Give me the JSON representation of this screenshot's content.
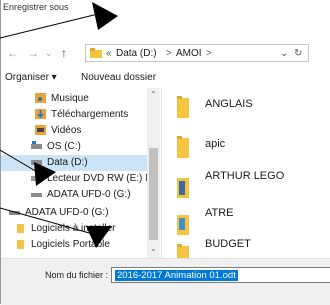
{
  "title": "Enregistrer sous",
  "address": {
    "back": "←",
    "forward": "→",
    "recent": "⌄",
    "up": "↑",
    "sep": "«",
    "crumbs": [
      "Data (D:)",
      ">",
      "AMOI",
      ">"
    ],
    "dropdown": "⌄",
    "refresh": "↻"
  },
  "toolbar": {
    "organize": "Organiser ▾",
    "new_folder": "Nouveau dossier"
  },
  "sidebar": {
    "items": [
      {
        "label": "Musique",
        "icon": "music-icon"
      },
      {
        "label": "Téléchargements",
        "icon": "download-icon"
      },
      {
        "label": "Vidéos",
        "icon": "video-icon"
      },
      {
        "label": "OS (C:)",
        "icon": "drive-icon"
      },
      {
        "label": "Data (D:)",
        "icon": "drive-icon"
      },
      {
        "label": "Lecteur DVD RW (E:) N",
        "icon": "dvd-icon"
      },
      {
        "label": "ADATA UFD-0 (G:)",
        "icon": "usb-icon"
      },
      {
        "label": "ADATA UFD-0 (G:)",
        "icon": "usb-icon"
      },
      {
        "label": "Logiciels à installer",
        "icon": "folder-icon"
      },
      {
        "label": "Logiciels Portable",
        "icon": "folder-icon"
      }
    ]
  },
  "folders": [
    "ANGLAIS",
    "apic",
    "ARTHUR LEGO",
    "ATRE",
    "BUDGET"
  ],
  "bottom": {
    "filename_label": "Nom du fichier :",
    "filename_value": "2016-2017 Animation 01.odt"
  },
  "colors": {
    "selection": "#cce4f7",
    "accent": "#0078d7",
    "folder": "#f5c542"
  }
}
